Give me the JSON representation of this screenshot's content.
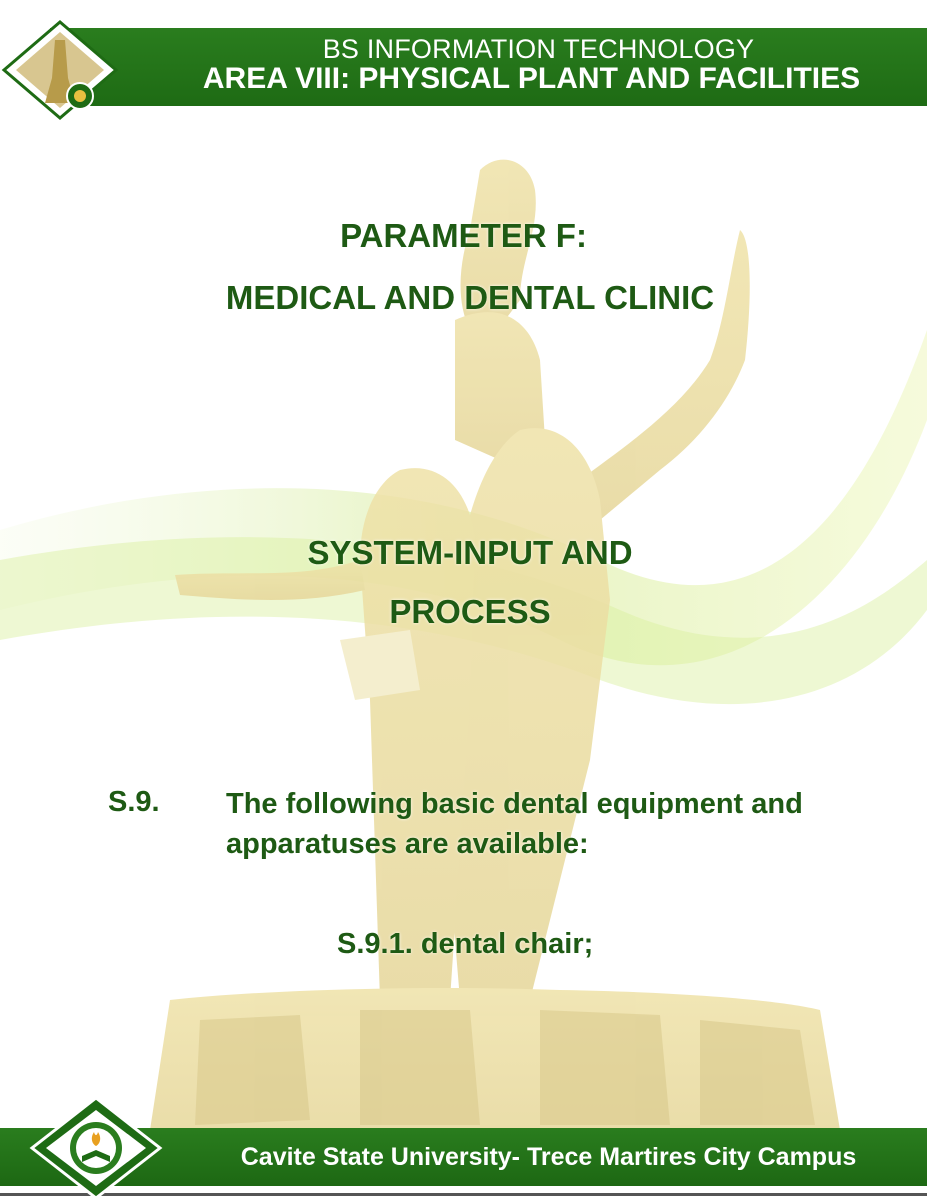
{
  "header": {
    "program": "BS INFORMATION TECHNOLOGY",
    "area": "AREA VIII: PHYSICAL PLANT AND FACILITIES"
  },
  "parameter": {
    "title": "PARAMETER F:",
    "subtitle": "MEDICAL AND DENTAL CLINIC"
  },
  "section": {
    "line1": "SYSTEM-INPUT AND",
    "line2": "PROCESS"
  },
  "standard": {
    "number": "S.9.",
    "text": "The following basic dental equipment and apparatuses are available:",
    "sub_item": "S.9.1. dental chair;"
  },
  "footer": {
    "campus": "Cavite State University- Trece Martires City Campus"
  },
  "colors": {
    "band_green": "#1e6b14",
    "title_green": "#1e5a14",
    "swoosh_green": "#c8e87a"
  }
}
